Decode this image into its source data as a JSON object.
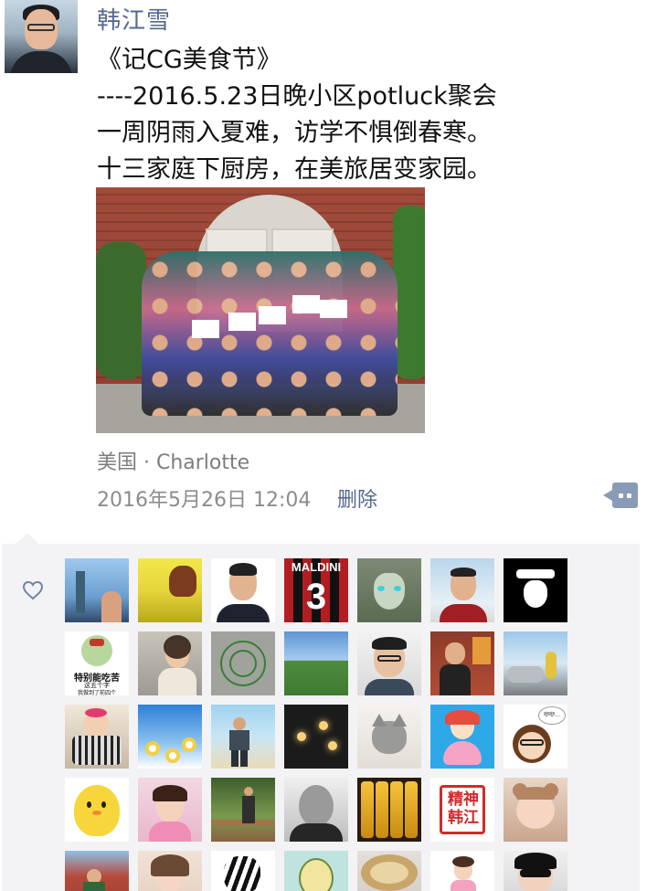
{
  "post": {
    "author": "韩江雪",
    "lines": [
      "《记CG美食节》",
      "----2016.5.23日晚小区potluck聚会",
      "一周阴雨入夏难，访学不惧倒春寒。",
      "十三家庭下厨房，在美旅居变家园。"
    ],
    "location": "美国 · Charlotte",
    "timestamp": "2016年5月26日 12:04",
    "delete_label": "删除"
  },
  "icons": {
    "like": "heart-icon",
    "more": "comment-bubble-icon"
  },
  "colors": {
    "name_link": "#56688f",
    "meta_gray": "#8c8c8c",
    "panel_bg": "#f3f3f5",
    "more_button": "#8a9bb7"
  },
  "likes": {
    "avatars": [
      "liberty-statue-selfie",
      "horse-yellow-field",
      "man-portrait",
      "maldini-jersey-3",
      "elf-cartoon",
      "man-outdoor-portrait",
      "masked-figure",
      "cartoon-soldier-sticker",
      "woman-car-photo",
      "green-sketch-circle",
      "green-hills-landscape",
      "glasses-man-portrait",
      "man-red-wall",
      "woman-beach-car",
      "baby-chair",
      "white-flowers-sky",
      "man-beach",
      "hanging-lights",
      "gray-cat",
      "cartoon-girl-pink",
      "cartoon-glasses-girl",
      "yellow-chick",
      "little-girl-flowers",
      "man-wooden-bridge",
      "bald-man-bw",
      "yellow-lanterns",
      "red-seal-stamp",
      "baby-bear-hat",
      "family-brick-wall",
      "young-woman-portrait",
      "zebra",
      "green-cartoon-face",
      "empty-bowl",
      "toddler-girl",
      "woman-sunglasses"
    ],
    "sticker_text": [
      "特别能吃苦",
      "这五个字",
      "我做到了前四个"
    ],
    "bubble_text": "咿咿…",
    "seal_text": "精神韩江"
  }
}
